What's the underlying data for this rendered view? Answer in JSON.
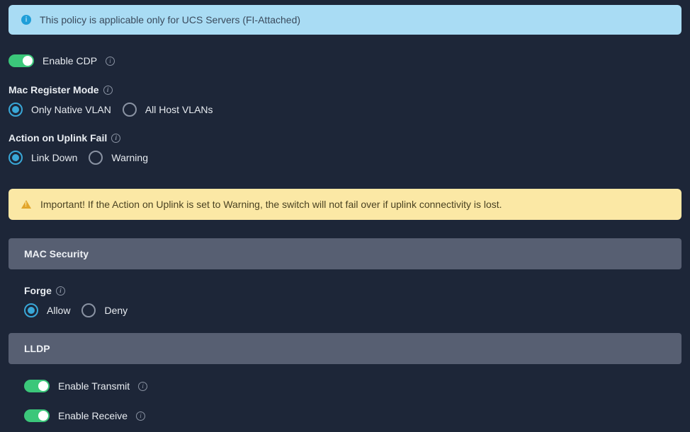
{
  "infoBanner": {
    "text": "This policy is applicable only for UCS Servers (FI-Attached)"
  },
  "cdp": {
    "label": "Enable CDP"
  },
  "macRegister": {
    "label": "Mac Register Mode",
    "options": {
      "native": "Only Native VLAN",
      "allhosts": "All Host VLANs"
    }
  },
  "uplinkFail": {
    "label": "Action on Uplink Fail",
    "options": {
      "linkdown": "Link Down",
      "warning": "Warning"
    }
  },
  "warnBanner": {
    "text": "Important! If the Action on Uplink is set to Warning, the switch will not fail over if uplink connectivity is lost."
  },
  "sections": {
    "macSecurity": "MAC Security",
    "lldp": "LLDP"
  },
  "forge": {
    "label": "Forge",
    "options": {
      "allow": "Allow",
      "deny": "Deny"
    }
  },
  "lldp": {
    "transmit": "Enable Transmit",
    "receive": "Enable Receive"
  }
}
